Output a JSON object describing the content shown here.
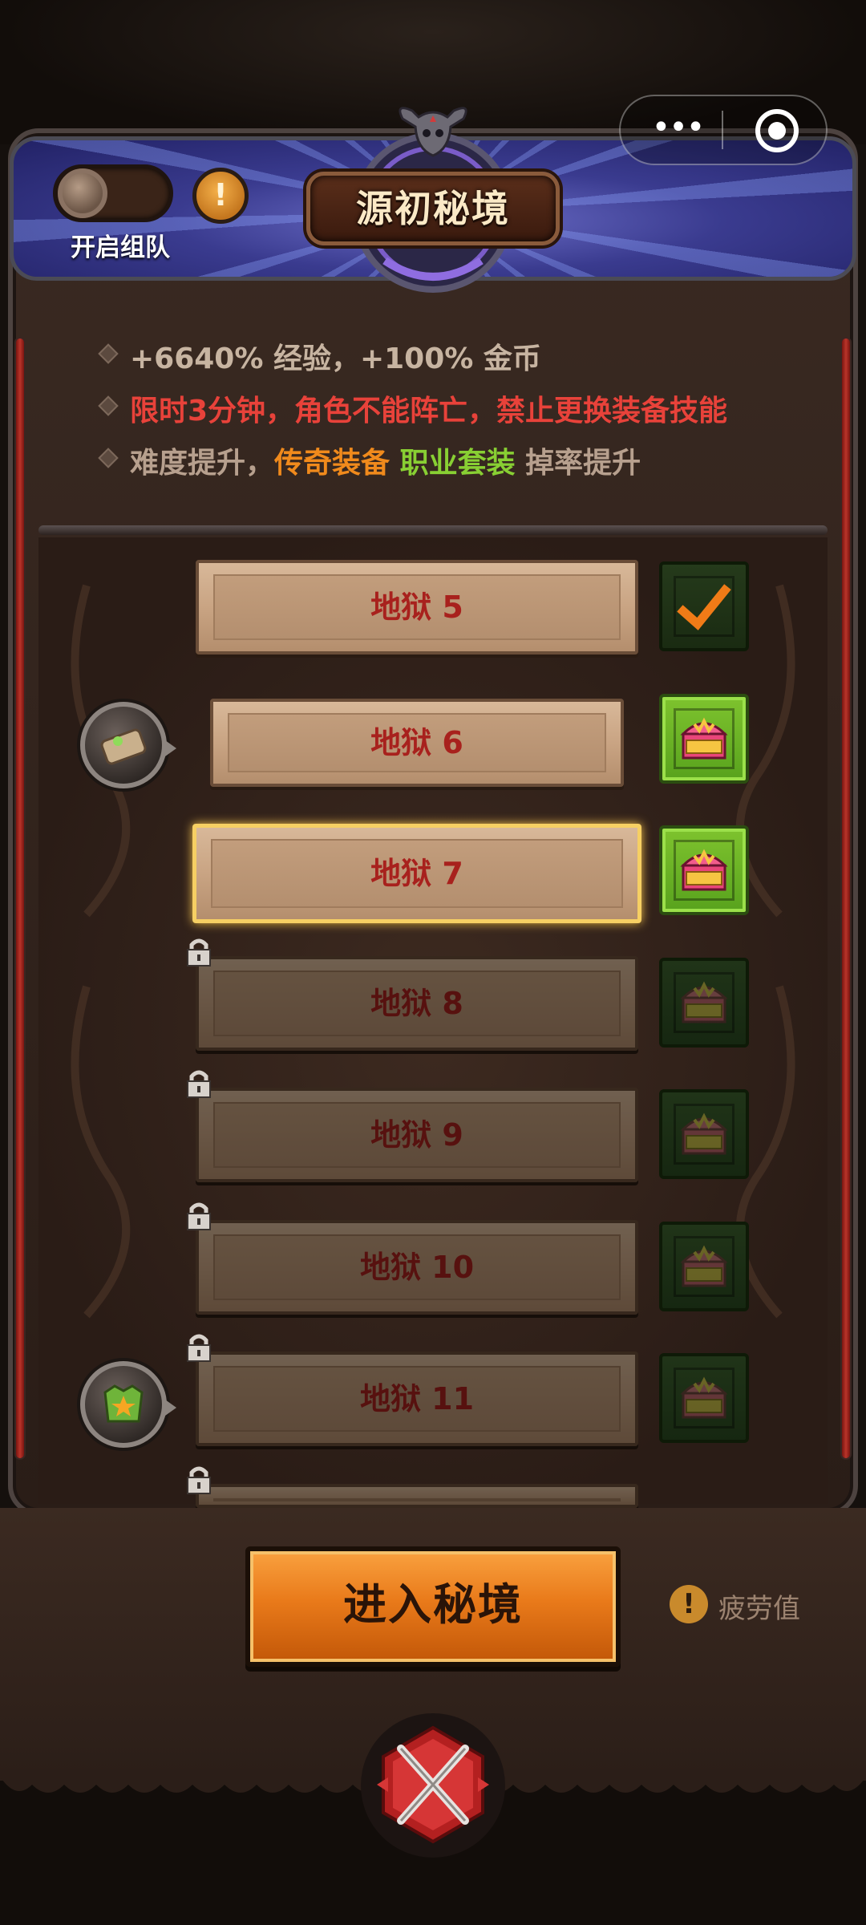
{
  "header": {
    "title": "源初秘境",
    "team_toggle_label": "开启组队",
    "info_button": "!"
  },
  "capsule": {
    "more": "•••"
  },
  "info": {
    "line1": "+6640% 经验，+100% 金币",
    "line2": "限时3分钟，角色不能阵亡，禁止更换装备技能",
    "line3_parts": [
      "难度提升，",
      "传奇装备",
      " ",
      "职业套装",
      " 掉率提升"
    ],
    "colors": {
      "default": "#c7b4a1",
      "warning": "#e8423a",
      "legendary": "#f08a1c",
      "set": "#88cf33",
      "muted": "#b7a08e"
    }
  },
  "levels": [
    {
      "label": "地狱 5",
      "state": "completed",
      "reward": "claimed"
    },
    {
      "label": "地狱 6",
      "state": "unlocked",
      "reward": "available",
      "badge": "scroll-medal"
    },
    {
      "label": "地狱 7",
      "state": "selected",
      "reward": "available"
    },
    {
      "label": "地狱 8",
      "state": "locked",
      "reward": "locked"
    },
    {
      "label": "地狱 9",
      "state": "locked",
      "reward": "locked"
    },
    {
      "label": "地狱 10",
      "state": "locked",
      "reward": "locked"
    },
    {
      "label": "地狱 11",
      "state": "locked",
      "reward": "locked",
      "badge": "armor-medal"
    },
    {
      "label": "",
      "state": "locked",
      "reward": "locked"
    }
  ],
  "footer": {
    "enter_button": "进入秘境",
    "fatigue_label": "疲劳值",
    "fatigue_icon": "!"
  }
}
